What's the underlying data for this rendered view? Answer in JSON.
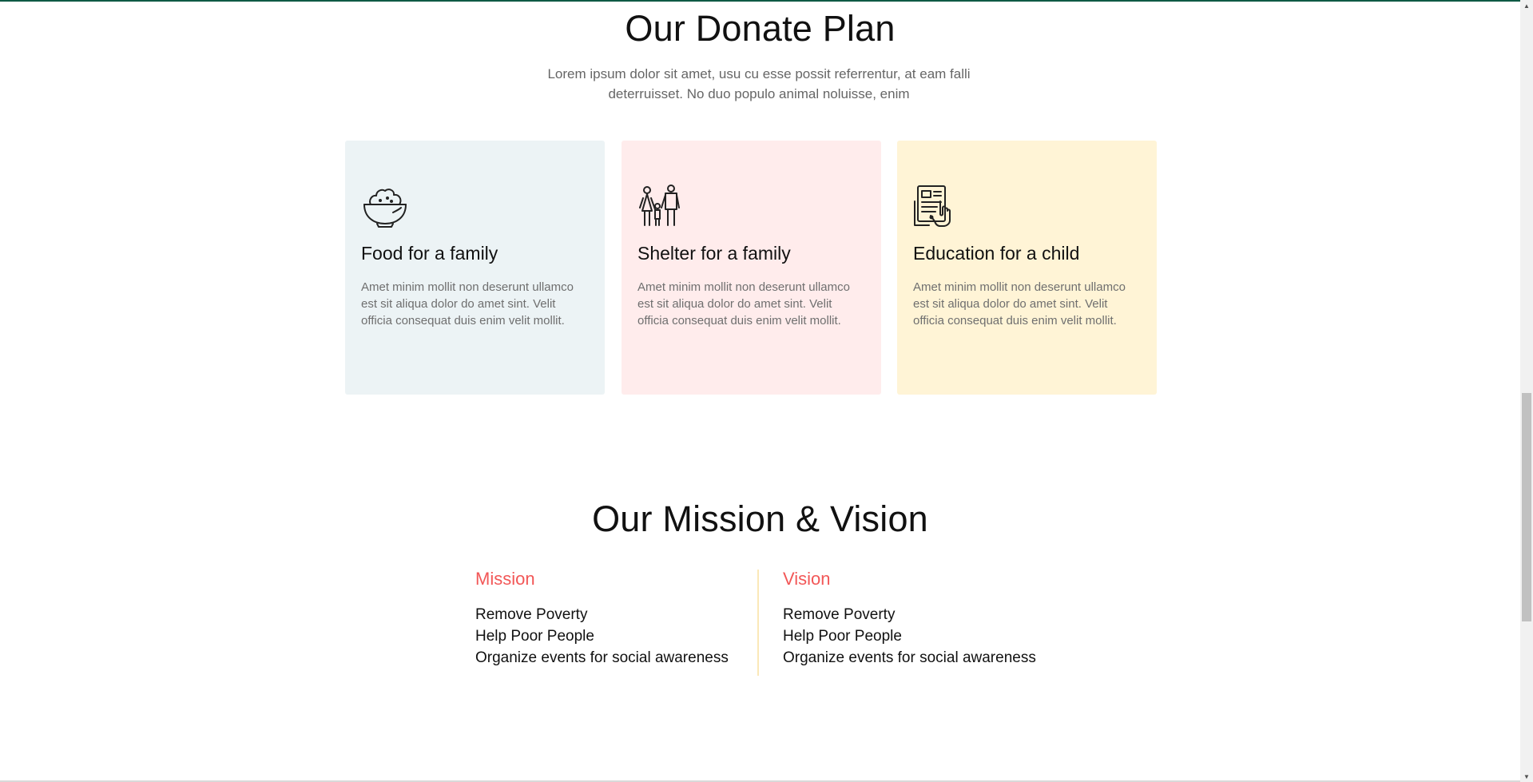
{
  "donate": {
    "title": "Our Donate Plan",
    "subtitle": "Lorem ipsum dolor sit amet, usu cu esse possit referrentur, at eam falli deterruisset. No duo populo animal noluisse, enim",
    "cards": [
      {
        "icon": "rice-bowl-icon",
        "title": "Food for a family",
        "text": "Amet minim mollit non deserunt ullamco est sit aliqua dolor do amet sint. Velit officia consequat duis enim velit mollit.",
        "bg": "#ecf3f5"
      },
      {
        "icon": "family-icon",
        "title": "Shelter for a family",
        "text": "Amet minim mollit non deserunt ullamco est sit aliqua dolor do amet sint. Velit officia consequat duis enim velit mollit.",
        "bg": "#ffecec"
      },
      {
        "icon": "tablet-learning-icon",
        "title": "Education for a child",
        "text": "Amet minim mollit non deserunt ullamco est sit aliqua dolor do amet sint. Velit officia consequat duis enim velit mollit.",
        "bg": "#fff4d6"
      }
    ]
  },
  "mission_vision": {
    "title": "Our Mission & Vision",
    "mission": {
      "heading": "Mission",
      "items": [
        "Remove Poverty",
        "Help Poor People",
        "Organize events for social awareness"
      ]
    },
    "vision": {
      "heading": "Vision",
      "items": [
        "Remove Poverty",
        "Help Poor People",
        "Organize events for social awareness"
      ]
    }
  },
  "colors": {
    "accent": "#f25757",
    "top_border": "#0e5a45",
    "divider": "#fbe8b8"
  }
}
